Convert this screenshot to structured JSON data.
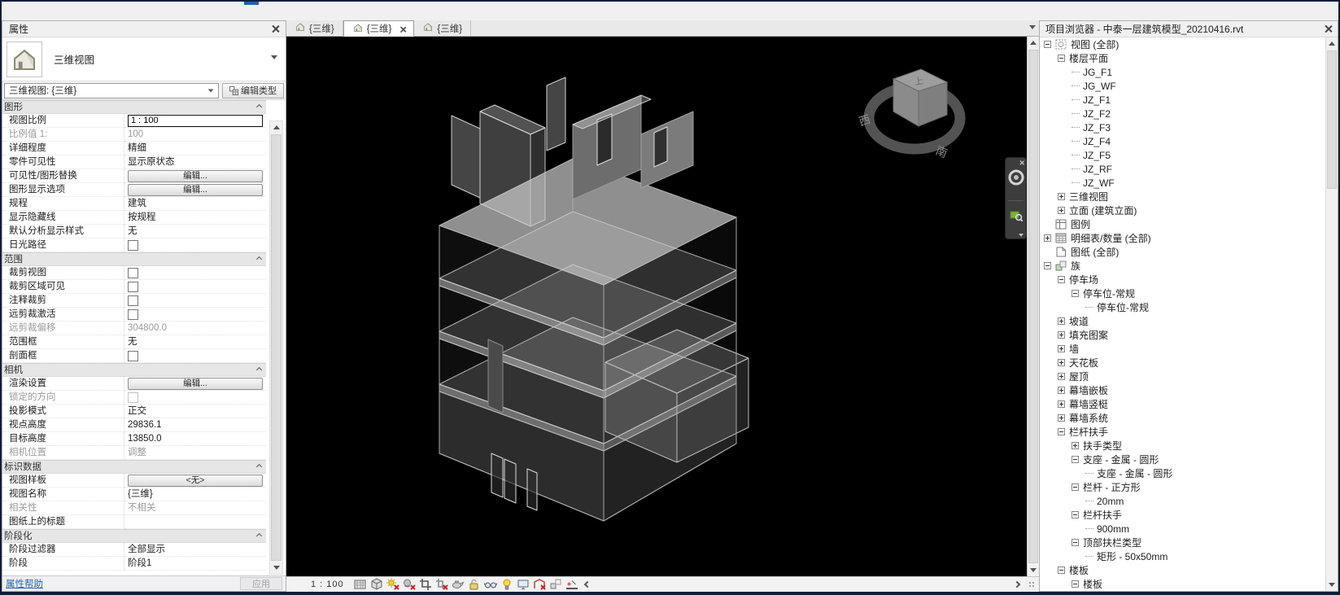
{
  "window": {
    "accent_color": "#2b5fa7"
  },
  "properties_panel": {
    "title": "属性",
    "selector": {
      "type_label": "三维视图"
    },
    "type_selector": {
      "value": "三维视图: {三维}",
      "edit_type_label": "编辑类型"
    },
    "sections": [
      {
        "header": "图形",
        "rows": [
          {
            "label": "视图比例",
            "kind": "input",
            "value": "1 : 100"
          },
          {
            "label": "比例值 1:",
            "kind": "text",
            "value": "100",
            "disabled": true
          },
          {
            "label": "详细程度",
            "kind": "text",
            "value": "精细"
          },
          {
            "label": "零件可见性",
            "kind": "text",
            "value": "显示原状态"
          },
          {
            "label": "可见性/图形替换",
            "kind": "button",
            "value": "编辑..."
          },
          {
            "label": "图形显示选项",
            "kind": "button",
            "value": "编辑..."
          },
          {
            "label": "规程",
            "kind": "text",
            "value": "建筑"
          },
          {
            "label": "显示隐藏线",
            "kind": "text",
            "value": "按规程"
          },
          {
            "label": "默认分析显示样式",
            "kind": "text",
            "value": "无"
          },
          {
            "label": "日光路径",
            "kind": "checkbox",
            "value": false
          }
        ]
      },
      {
        "header": "范围",
        "rows": [
          {
            "label": "裁剪视图",
            "kind": "checkbox",
            "value": false
          },
          {
            "label": "裁剪区域可见",
            "kind": "checkbox",
            "value": false
          },
          {
            "label": "注释裁剪",
            "kind": "checkbox",
            "value": false
          },
          {
            "label": "远剪裁激活",
            "kind": "checkbox",
            "value": false
          },
          {
            "label": "远剪裁偏移",
            "kind": "text",
            "value": "304800.0",
            "disabled": true
          },
          {
            "label": "范围框",
            "kind": "text",
            "value": "无"
          },
          {
            "label": "剖面框",
            "kind": "checkbox",
            "value": false
          }
        ]
      },
      {
        "header": "相机",
        "rows": [
          {
            "label": "渲染设置",
            "kind": "button",
            "value": "编辑..."
          },
          {
            "label": "锁定的方向",
            "kind": "checkbox",
            "value": false,
            "disabled": true
          },
          {
            "label": "投影模式",
            "kind": "text",
            "value": "正交"
          },
          {
            "label": "视点高度",
            "kind": "text",
            "value": "29836.1"
          },
          {
            "label": "目标高度",
            "kind": "text",
            "value": "13850.0"
          },
          {
            "label": "相机位置",
            "kind": "text",
            "value": "调整",
            "disabled": true
          }
        ]
      },
      {
        "header": "标识数据",
        "rows": [
          {
            "label": "视图样板",
            "kind": "button",
            "value": "<无>"
          },
          {
            "label": "视图名称",
            "kind": "text",
            "value": "{三维}"
          },
          {
            "label": "相关性",
            "kind": "text",
            "value": "不相关",
            "disabled": true
          },
          {
            "label": "图纸上的标题",
            "kind": "text",
            "value": ""
          }
        ]
      },
      {
        "header": "阶段化",
        "rows": [
          {
            "label": "阶段过滤器",
            "kind": "text",
            "value": "全部显示"
          },
          {
            "label": "阶段",
            "kind": "text",
            "value": "阶段1"
          }
        ]
      }
    ],
    "footer": {
      "help_link": "属性帮助",
      "apply_label": "应用"
    }
  },
  "tabs": {
    "items": [
      {
        "label": "{三维}",
        "active": false
      },
      {
        "label": "{三维}",
        "active": true
      },
      {
        "label": "{三维}",
        "active": false
      }
    ]
  },
  "view_control_bar": {
    "scale": "1 : 100",
    "icons": [
      "detail-level",
      "visual-style",
      "sun-path-off",
      "shadows-off",
      "crop-view",
      "crop-region-off",
      "rendering-dialog",
      "unlocked-view",
      "temporary-hide-isolate",
      "reveal-hidden-elements",
      "temporary-view-properties",
      "analytical-model-off",
      "displacement-sets",
      "reveal-constraints"
    ]
  },
  "viewcube": {
    "ring_labels": [
      "西",
      "南"
    ],
    "cube_top_label": "上"
  },
  "navigation_bar": {
    "tools": [
      "steering-wheel",
      "zoom-region"
    ]
  },
  "project_browser": {
    "title": "项目浏览器 - 中泰一层建筑模型_20210416.rvt",
    "tree": [
      {
        "d": 0,
        "exp": "minus",
        "icon": "views",
        "label": "视图 (全部)"
      },
      {
        "d": 1,
        "exp": "minus",
        "label": "楼层平面"
      },
      {
        "d": 2,
        "exp": "leaf",
        "label": "JG_F1"
      },
      {
        "d": 2,
        "exp": "leaf",
        "label": "JG_WF"
      },
      {
        "d": 2,
        "exp": "leaf",
        "label": "JZ_F1"
      },
      {
        "d": 2,
        "exp": "leaf",
        "label": "JZ_F2"
      },
      {
        "d": 2,
        "exp": "leaf",
        "label": "JZ_F3"
      },
      {
        "d": 2,
        "exp": "leaf",
        "label": "JZ_F4"
      },
      {
        "d": 2,
        "exp": "leaf",
        "label": "JZ_F5"
      },
      {
        "d": 2,
        "exp": "leaf",
        "label": "JZ_RF"
      },
      {
        "d": 2,
        "exp": "leaf",
        "label": "JZ_WF"
      },
      {
        "d": 1,
        "exp": "plus",
        "label": "三维视图"
      },
      {
        "d": 1,
        "exp": "plus",
        "label": "立面 (建筑立面)"
      },
      {
        "d": 0,
        "exp": "none",
        "icon": "legend",
        "label": "图例"
      },
      {
        "d": 0,
        "exp": "plus",
        "icon": "schedule",
        "label": "明细表/数量 (全部)"
      },
      {
        "d": 0,
        "exp": "none",
        "icon": "sheet",
        "label": "图纸 (全部)"
      },
      {
        "d": 0,
        "exp": "minus",
        "icon": "family",
        "label": "族"
      },
      {
        "d": 1,
        "exp": "minus",
        "label": "停车场"
      },
      {
        "d": 2,
        "exp": "minus",
        "label": "停车位-常规"
      },
      {
        "d": 3,
        "exp": "leaf",
        "label": "停车位-常规"
      },
      {
        "d": 1,
        "exp": "plus",
        "label": "坡道"
      },
      {
        "d": 1,
        "exp": "plus",
        "label": "填充图案"
      },
      {
        "d": 1,
        "exp": "plus",
        "label": "墙"
      },
      {
        "d": 1,
        "exp": "plus",
        "label": "天花板"
      },
      {
        "d": 1,
        "exp": "plus",
        "label": "屋顶"
      },
      {
        "d": 1,
        "exp": "plus",
        "label": "幕墙嵌板"
      },
      {
        "d": 1,
        "exp": "plus",
        "label": "幕墙竖梃"
      },
      {
        "d": 1,
        "exp": "plus",
        "label": "幕墙系统"
      },
      {
        "d": 1,
        "exp": "minus",
        "label": "栏杆扶手"
      },
      {
        "d": 2,
        "exp": "plus",
        "label": "扶手类型"
      },
      {
        "d": 2,
        "exp": "minus",
        "label": "支座 - 金属 - 圆形"
      },
      {
        "d": 3,
        "exp": "leaf",
        "label": "支座 - 金属 - 圆形"
      },
      {
        "d": 2,
        "exp": "minus",
        "label": "栏杆 - 正方形"
      },
      {
        "d": 3,
        "exp": "leaf",
        "label": "20mm"
      },
      {
        "d": 2,
        "exp": "minus",
        "label": "栏杆扶手"
      },
      {
        "d": 3,
        "exp": "leaf",
        "label": "900mm"
      },
      {
        "d": 2,
        "exp": "minus",
        "label": "顶部扶栏类型"
      },
      {
        "d": 3,
        "exp": "leaf",
        "label": "矩形 - 50x50mm"
      },
      {
        "d": 1,
        "exp": "minus",
        "label": "楼板"
      },
      {
        "d": 2,
        "exp": "minus",
        "label": "楼板"
      }
    ]
  }
}
